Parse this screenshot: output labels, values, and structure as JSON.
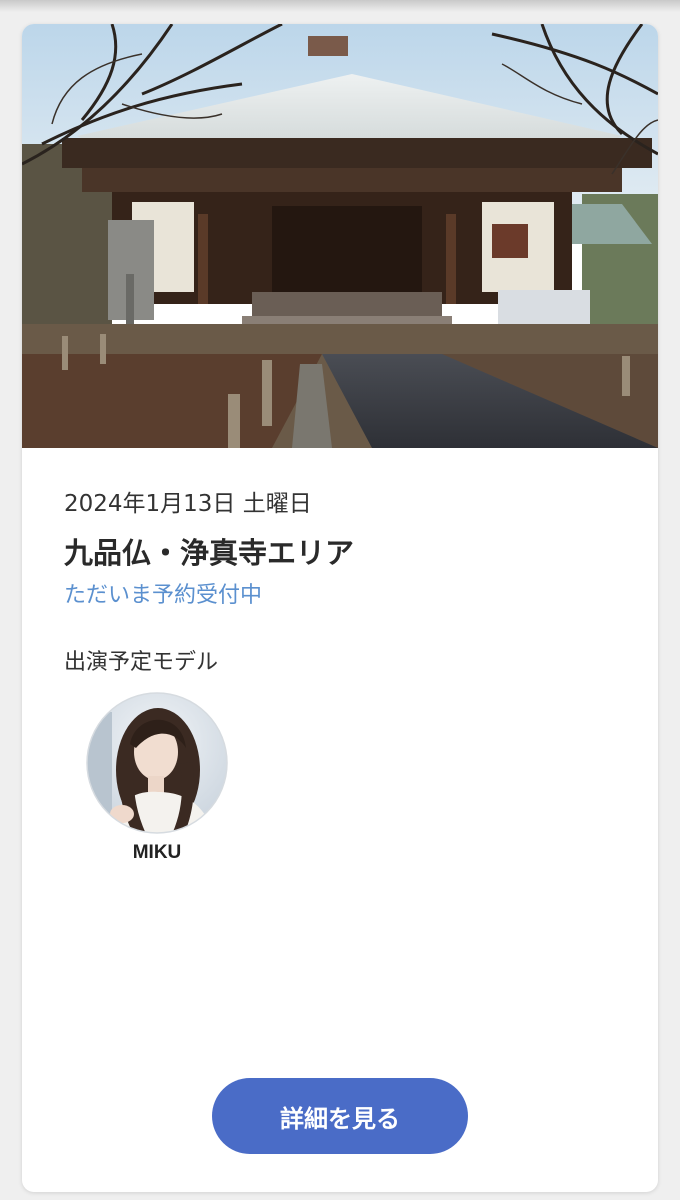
{
  "event": {
    "date": "2024年1月13日 土曜日",
    "title": "九品仏・浄真寺エリア",
    "status": "ただいま予約受付中",
    "models_heading": "出演予定モデル",
    "models": [
      {
        "name": "MIKU"
      }
    ],
    "details_button_label": "詳細を見る"
  },
  "colors": {
    "status_text": "#5b90cf",
    "button_background": "#4a6cc7",
    "button_text": "#ffffff"
  }
}
